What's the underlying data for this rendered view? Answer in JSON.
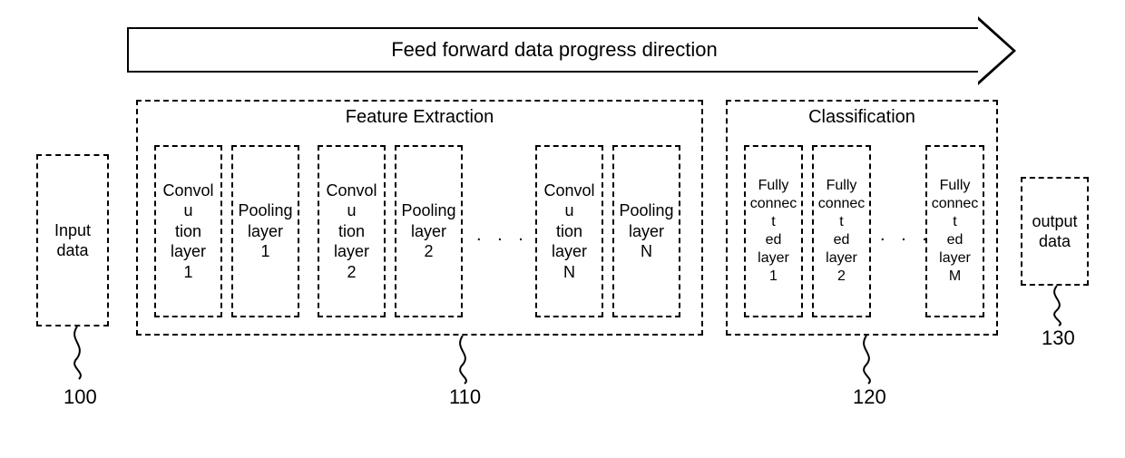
{
  "arrow_label": "Feed forward data progress direction",
  "input_block": {
    "label": "Input\ndata",
    "ref": "100"
  },
  "feature_group": {
    "title": "Feature Extraction",
    "ref": "110",
    "layers": [
      {
        "label": "Convolu\ntion\nlayer\n1"
      },
      {
        "label": "Pooling\nlayer\n1"
      },
      {
        "label": "Convolu\ntion\nlayer\n2"
      },
      {
        "label": "Pooling\nlayer\n2"
      },
      {
        "label": "Convolu\ntion\nlayer\nN"
      },
      {
        "label": "Pooling\nlayer\nN"
      }
    ]
  },
  "class_group": {
    "title": "Classification",
    "ref": "120",
    "layers": [
      {
        "label": "Fully\nconnect\ned layer\n1"
      },
      {
        "label": "Fully\nconnect\ned layer\n2"
      },
      {
        "label": "Fully\nconnect\ned layer\nM"
      }
    ]
  },
  "output_block": {
    "label": "output\ndata",
    "ref": "130"
  },
  "ellipsis": ". . .",
  "chart_data": {
    "type": "diagram",
    "title": "Feed forward data progress direction",
    "flow": [
      {
        "id": 100,
        "name": "Input data"
      },
      {
        "id": 110,
        "name": "Feature Extraction",
        "contents": [
          "Convolution layer 1",
          "Pooling layer 1",
          "Convolution layer 2",
          "Pooling layer 2",
          "…",
          "Convolution layer N",
          "Pooling layer N"
        ]
      },
      {
        "id": 120,
        "name": "Classification",
        "contents": [
          "Fully connected layer 1",
          "Fully connected layer 2",
          "…",
          "Fully connected layer M"
        ]
      },
      {
        "id": 130,
        "name": "output data"
      }
    ]
  }
}
